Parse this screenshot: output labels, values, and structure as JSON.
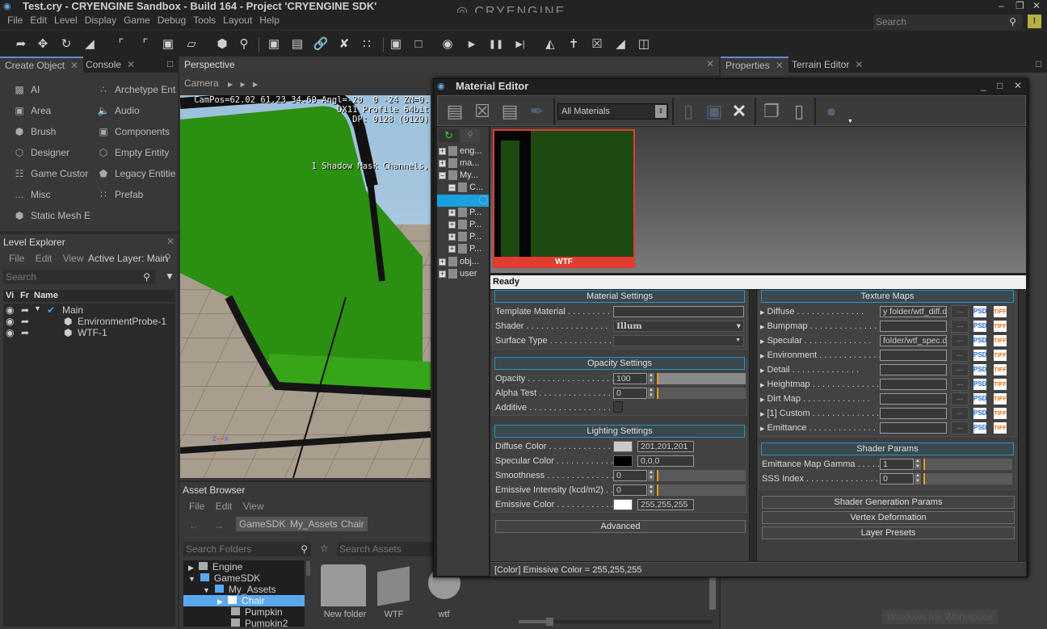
{
  "window": {
    "title": "Test.cry - CRYENGINE Sandbox - Build 164 - Project 'CRYENGINE SDK'",
    "brand": "CRYENGINE",
    "search_placeholder": "Search",
    "alert_label": "!"
  },
  "menu": [
    "File",
    "Edit",
    "Level",
    "Display",
    "Game",
    "Debug",
    "Tools",
    "Layout",
    "Help"
  ],
  "toolbar_icons": [
    "select-icon",
    "move-icon",
    "rotate-icon",
    "scale-icon",
    "snap-grid-icon",
    "snap-angle-icon",
    "snap-scale-icon",
    "snap-terrain-icon",
    "select-object-icon",
    "search-icon",
    "group-icon",
    "ungroup-icon",
    "link-icon",
    "unlink-icon",
    "align-icon",
    "lock-icon",
    "unlock-icon",
    "game-mode-icon",
    "play-icon",
    "pause-icon",
    "step-icon",
    "gate-icon",
    "character-icon",
    "prefab-icon",
    "terrain-icon",
    "flowgraph-icon"
  ],
  "left_tabs": {
    "create_object": "Create Object",
    "console": "Console"
  },
  "create_object": {
    "items": [
      {
        "label": "AI",
        "icon": "ai-icon"
      },
      {
        "label": "Archetype Ent",
        "icon": "archetype-icon"
      },
      {
        "label": "Area",
        "icon": "area-icon"
      },
      {
        "label": "Audio",
        "icon": "audio-icon"
      },
      {
        "label": "Brush",
        "icon": "brush-icon"
      },
      {
        "label": "Components",
        "icon": "components-icon"
      },
      {
        "label": "Designer",
        "icon": "designer-icon"
      },
      {
        "label": "Empty Entity",
        "icon": "empty-entity-icon"
      },
      {
        "label": "Game Custor",
        "icon": "ladder-icon"
      },
      {
        "label": "Legacy Entitie",
        "icon": "legacy-entity-icon"
      },
      {
        "label": "Misc",
        "icon": "misc-icon"
      },
      {
        "label": "Prefab",
        "icon": "prefab-icon"
      },
      {
        "label": "Static Mesh E",
        "icon": "static-mesh-icon"
      }
    ]
  },
  "level_explorer": {
    "title": "Level Explorer",
    "menu": [
      "File",
      "Edit",
      "View"
    ],
    "active_layer": "Active Layer: Main",
    "search_placeholder": "Search",
    "columns": [
      "Vi",
      "Fr",
      "Name"
    ],
    "rows": [
      {
        "name": "Main",
        "type": "layer"
      },
      {
        "name": "EnvironmentProbe-1",
        "type": "entity"
      },
      {
        "name": "WTF-1",
        "type": "entity"
      }
    ]
  },
  "viewport": {
    "tab": "Perspective",
    "camera_label": "Camera",
    "osd_line1": "CamPos=62.02 61.23 34.69 Angl=-20  0 -24 ZN=0.",
    "osd_line2": "DX11 Profile 64bit",
    "osd_line3": "DP: 0128 (0129)",
    "osd_line4": "1 Shadow Mask Channels,"
  },
  "asset_browser": {
    "title": "Asset Browser",
    "menu": [
      "File",
      "Edit",
      "View"
    ],
    "breadcrumb": [
      "GameSDK",
      "My_Assets",
      "Chair"
    ],
    "search_folders_placeholder": "Search Folders",
    "search_assets_placeholder": "Search Assets",
    "folders": [
      {
        "name": "Engine",
        "level": 0,
        "expanded": false
      },
      {
        "name": "GameSDK",
        "level": 0,
        "expanded": true
      },
      {
        "name": "My_Assets",
        "level": 1,
        "expanded": true
      },
      {
        "name": "Chair",
        "level": 2,
        "selected": true
      },
      {
        "name": "Pumpkin",
        "level": 2
      },
      {
        "name": "Pumpkin2",
        "level": 2
      }
    ],
    "assets": [
      "New folder",
      "WTF",
      "wtf"
    ],
    "zoom_slider": 0.14
  },
  "right_tabs": {
    "properties": "Properties",
    "terrain_editor": "Terrain Editor"
  },
  "material_editor": {
    "title": "Material Editor",
    "filter": "All Materials",
    "tree": [
      {
        "label": "eng...",
        "level": 0,
        "sign": "+"
      },
      {
        "label": "ma...",
        "level": 0,
        "sign": "+"
      },
      {
        "label": "My...",
        "level": 0,
        "sign": "-"
      },
      {
        "label": "C...",
        "level": 1,
        "sign": "-"
      },
      {
        "label": "",
        "level": 2,
        "selected": true
      },
      {
        "label": "P...",
        "level": 1,
        "sign": "+"
      },
      {
        "label": "P...",
        "level": 1,
        "sign": "+"
      },
      {
        "label": "P...",
        "level": 1,
        "sign": "+"
      },
      {
        "label": "P...",
        "level": 1,
        "sign": "+"
      },
      {
        "label": "obj...",
        "level": 0,
        "sign": "+"
      },
      {
        "label": "user",
        "level": 0,
        "sign": "+"
      }
    ],
    "preview_name": "WTF",
    "status": "Ready",
    "material_settings": {
      "header": "Material Settings",
      "template_label": "Template Material",
      "template_value": "",
      "shader_label": "Shader",
      "shader_value": "Illum",
      "surface_label": "Surface Type",
      "surface_value": ""
    },
    "opacity_settings": {
      "header": "Opacity Settings",
      "opacity_label": "Opacity",
      "opacity_value": "100",
      "opacity_fraction": 1.0,
      "alpha_label": "Alpha Test",
      "alpha_value": "0",
      "alpha_fraction": 0,
      "additive_label": "Additive"
    },
    "lighting_settings": {
      "header": "Lighting Settings",
      "diffuse_label": "Diffuse Color",
      "diffuse_value": "201,201,201",
      "diffuse_color": "#c9c9c9",
      "specular_label": "Specular Color",
      "specular_value": "0,0,0",
      "specular_color": "#000000",
      "smoothness_label": "Smoothness",
      "smoothness_value": "0",
      "emissive_int_label": "Emissive Intensity (kcd/m2)",
      "emissive_int_value": "0",
      "emissive_label": "Emissive Color",
      "emissive_value": "255,255,255",
      "emissive_color": "#ffffff"
    },
    "advanced_label": "Advanced",
    "texture_maps": {
      "header": "Texture Maps",
      "rows": [
        {
          "label": "Diffuse",
          "value": "y folder/wtf_diff.d"
        },
        {
          "label": "Bumpmap",
          "value": ""
        },
        {
          "label": "Specular",
          "value": " folder/wtf_spec.d"
        },
        {
          "label": "Environment",
          "value": ""
        },
        {
          "label": "Detail",
          "value": ""
        },
        {
          "label": "Heightmap",
          "value": ""
        },
        {
          "label": "Dirt Map",
          "value": ""
        },
        {
          "label": "[1] Custom",
          "value": ""
        },
        {
          "label": "Emittance",
          "value": ""
        }
      ],
      "browse_label": "...",
      "psd_label": "PSD",
      "tiff_label": "TIFF"
    },
    "shader_params": {
      "header": "Shader Params",
      "gamma_label": "Emittance Map Gamma",
      "gamma_value": "1",
      "sss_label": "SSS Index",
      "sss_value": "0"
    },
    "collapsed_sections": [
      "Shader Generation Params",
      "Vertex Deformation",
      "Layer Presets"
    ],
    "footer_status": "[Color] Emissive Color = 255,255,255"
  },
  "taskbar_hint": "Windows Ink Workspace"
}
